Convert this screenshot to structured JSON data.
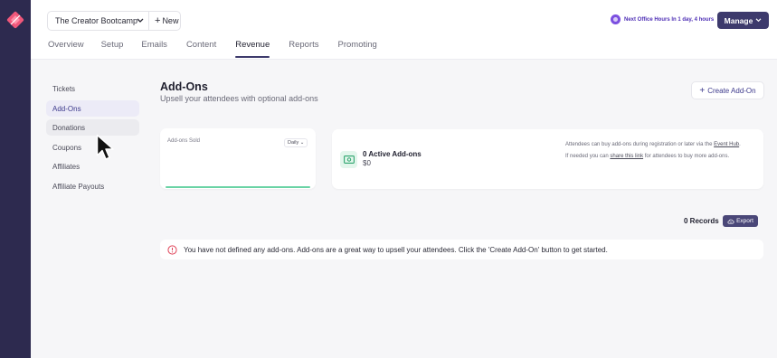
{
  "brand_color": "#3d3a6c",
  "accent_purple": "#7b4fe0",
  "accent_green": "#6ad3a5",
  "alert_red": "#e0455a",
  "topbar": {
    "event_name": "The Creator Bootcamp",
    "new_label": "New",
    "office_hours": "Next Office Hours In 1 day, 4 hours",
    "manage_label": "Manage"
  },
  "tabs": [
    {
      "label": "Overview"
    },
    {
      "label": "Setup"
    },
    {
      "label": "Emails"
    },
    {
      "label": "Content"
    },
    {
      "label": "Revenue"
    },
    {
      "label": "Reports"
    },
    {
      "label": "Promoting"
    }
  ],
  "active_tab": "Revenue",
  "sidebar": {
    "items": [
      {
        "label": "Tickets"
      },
      {
        "label": "Add-Ons"
      },
      {
        "label": "Donations"
      },
      {
        "label": "Coupons"
      },
      {
        "label": "Affiliates"
      },
      {
        "label": "Affiliate Payouts"
      }
    ],
    "active": "Add-Ons",
    "hovered": "Donations"
  },
  "page": {
    "title": "Add-Ons",
    "subtitle": "Upsell your attendees with optional add-ons",
    "create_label": "Create Add-On"
  },
  "chart_card": {
    "title": "Add-ons Sold",
    "period": "Daily"
  },
  "summary": {
    "active_count": "0 Active Add-ons",
    "amount": "$0",
    "info_1_pre": "Attendees can buy add-ons during registration or later via the",
    "info_1_link": "Event Hub",
    "info_1_post": ".",
    "info_2_pre": "If needed you can",
    "info_2_link": "share this link",
    "info_2_post": "for attendees to buy more add-ons."
  },
  "records": {
    "count": "0 Records",
    "export_label": "Export"
  },
  "alert": {
    "text": "You have not defined any add-ons. Add-ons are a great way to upsell your attendees. Click the 'Create Add-On' button to get started."
  }
}
